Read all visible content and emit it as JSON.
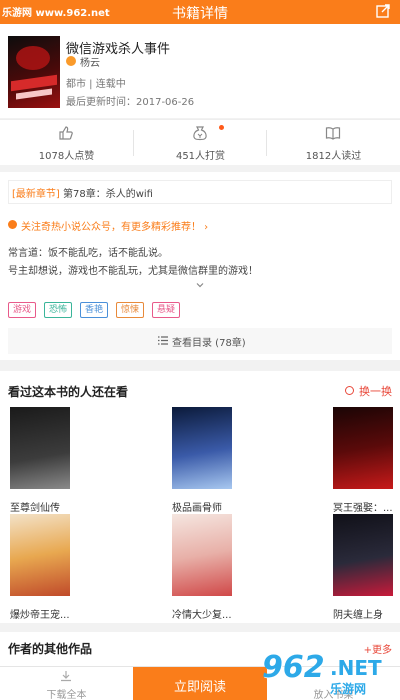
{
  "watermark": {
    "top": "乐游网 www.962.net",
    "logo_num": "962",
    "logo_net": ".NET",
    "logo_sub": "乐游网"
  },
  "header": {
    "title": "书籍详情"
  },
  "book": {
    "title": "微信游戏杀人事件",
    "author": "杨云",
    "category": "都市 | 连载中",
    "updated": "最后更新时间：2017-06-26"
  },
  "stats": {
    "likes": "1078人点赞",
    "tips": "451人打赏",
    "reads": "1812人读过"
  },
  "detail": {
    "latest_tag": "[最新章节]",
    "latest_chapter": "第78章：杀人的wifi",
    "promo": "关注奇热小说公众号，有更多精彩推荐！ ›",
    "desc_line1": "常言道：饭不能乱吃，话不能乱说。",
    "desc_line2": "号主却想说，游戏也不能乱玩，尤其是微信群里的游戏！",
    "tags": [
      {
        "label": "游戏",
        "color": "#e85a8a"
      },
      {
        "label": "恐怖",
        "color": "#3ab59a"
      },
      {
        "label": "香艳",
        "color": "#4a90d9"
      },
      {
        "label": "惊悚",
        "color": "#e88a3a"
      },
      {
        "label": "悬疑",
        "color": "#e85a8a"
      }
    ],
    "toc": "查看目录 (78章)"
  },
  "recommend": {
    "title": "看过这本书的人还在看",
    "refresh": "换一换",
    "books": [
      {
        "name": "至尊剑仙传"
      },
      {
        "name": "极品画骨师"
      },
      {
        "name": "冥王强娶：..."
      },
      {
        "name": "爆炒帝王宠..."
      },
      {
        "name": "冷情大少复..."
      },
      {
        "name": "阴夫缠上身"
      }
    ]
  },
  "others": {
    "title": "作者的其他作品",
    "more": "+更多"
  },
  "bottom": {
    "download": "下载全本",
    "read": "立即阅读",
    "shelf": "放入书架"
  },
  "colors": {
    "accent": "#fa7d1a",
    "red": "#e8483a"
  }
}
